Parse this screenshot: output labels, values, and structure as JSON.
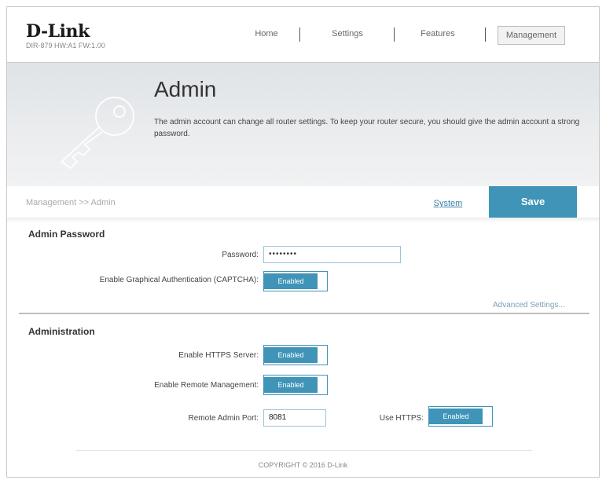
{
  "brand": {
    "logo": "D-Link",
    "model": "DIR-879 HW:A1 FW:1.00"
  },
  "nav": {
    "home": "Home",
    "settings": "Settings",
    "features": "Features",
    "management": "Management"
  },
  "banner": {
    "title": "Admin",
    "description": "The admin account can change all router settings. To keep your router secure, you should give the admin account a strong password."
  },
  "breadcrumb": "Management >> Admin",
  "actions": {
    "system": "System",
    "save": "Save"
  },
  "admin_password": {
    "title": "Admin Password",
    "password_label": "Password:",
    "password_value": "••••••••",
    "captcha_label": "Enable Graphical Authentication (CAPTCHA):",
    "captcha_value": "Enabled",
    "advanced_link": "Advanced Settings..."
  },
  "administration": {
    "title": "Administration",
    "https_label": "Enable HTTPS Server:",
    "https_value": "Enabled",
    "remote_label": "Enable Remote Management:",
    "remote_value": "Enabled",
    "port_label": "Remote Admin Port:",
    "port_value": "8081",
    "use_https_label": "Use HTTPS:",
    "use_https_value": "Enabled"
  },
  "footer": {
    "copyright": "COPYRIGHT © 2016 D-Link"
  },
  "colors": {
    "accent": "#3f94b8",
    "link": "#3a7fa5"
  }
}
